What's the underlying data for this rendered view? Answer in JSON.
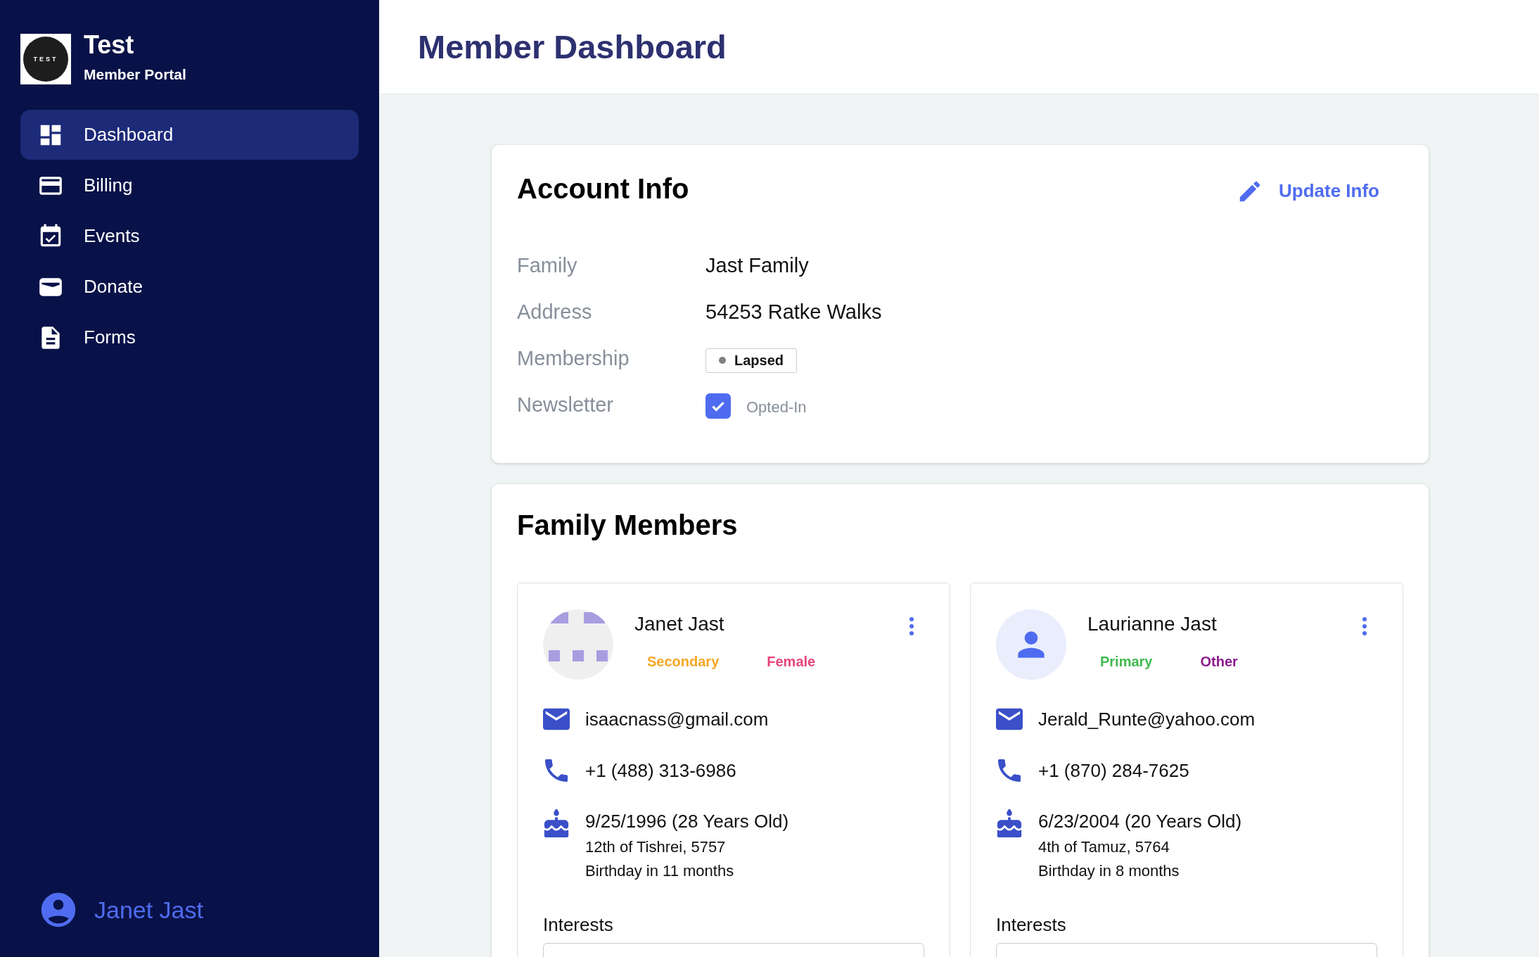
{
  "sidebar": {
    "logo_text": "TEST",
    "title": "Test",
    "subtitle": "Member Portal",
    "items": [
      {
        "label": "Dashboard",
        "selected": true
      },
      {
        "label": "Billing",
        "selected": false
      },
      {
        "label": "Events",
        "selected": false
      },
      {
        "label": "Donate",
        "selected": false
      },
      {
        "label": "Forms",
        "selected": false
      }
    ],
    "user": "Janet Jast"
  },
  "header": {
    "title": "Member Dashboard"
  },
  "account_info": {
    "title": "Account Info",
    "action": "Update Info",
    "fields": [
      {
        "kind": "text",
        "label": "Family",
        "value": "Jast Family"
      },
      {
        "kind": "text",
        "label": "Address",
        "value": "54253 Ratke Walks"
      },
      {
        "kind": "status",
        "label": "Membership",
        "value": "Lapsed"
      },
      {
        "kind": "checkbox",
        "label": "Newsletter",
        "value": "Opted-In",
        "checked": true
      }
    ]
  },
  "family_members": {
    "title": "Family Members",
    "members": [
      {
        "name": "Janet Jast",
        "tags": [
          {
            "label": "Secondary",
            "color": "#f5a623"
          },
          {
            "label": "Female",
            "color": "#e6457a"
          }
        ],
        "email": "isaacnass@gmail.com",
        "phone": "+1 (488) 313-6986",
        "birth_date": "9/25/1996 (28 Years Old)",
        "hebrew_date": "12th of Tishrei, 5757",
        "countdown": "Birthday in 11 months",
        "interests_label": "Interests"
      },
      {
        "name": "Laurianne Jast",
        "avatar": {
          "kind": "default"
        },
        "tags": [
          {
            "label": "Primary",
            "color": "#3fba4f"
          },
          {
            "label": "Other",
            "color": "#8b1a8b"
          }
        ],
        "email": "Jerald_Runte@yahoo.com",
        "phone": "+1 (870) 284-7625",
        "birth_date": "6/23/2004 (20 Years Old)",
        "hebrew_date": "4th of Tamuz, 5764",
        "countdown": "Birthday in 8 months",
        "interests_label": "Interests"
      }
    ]
  }
}
